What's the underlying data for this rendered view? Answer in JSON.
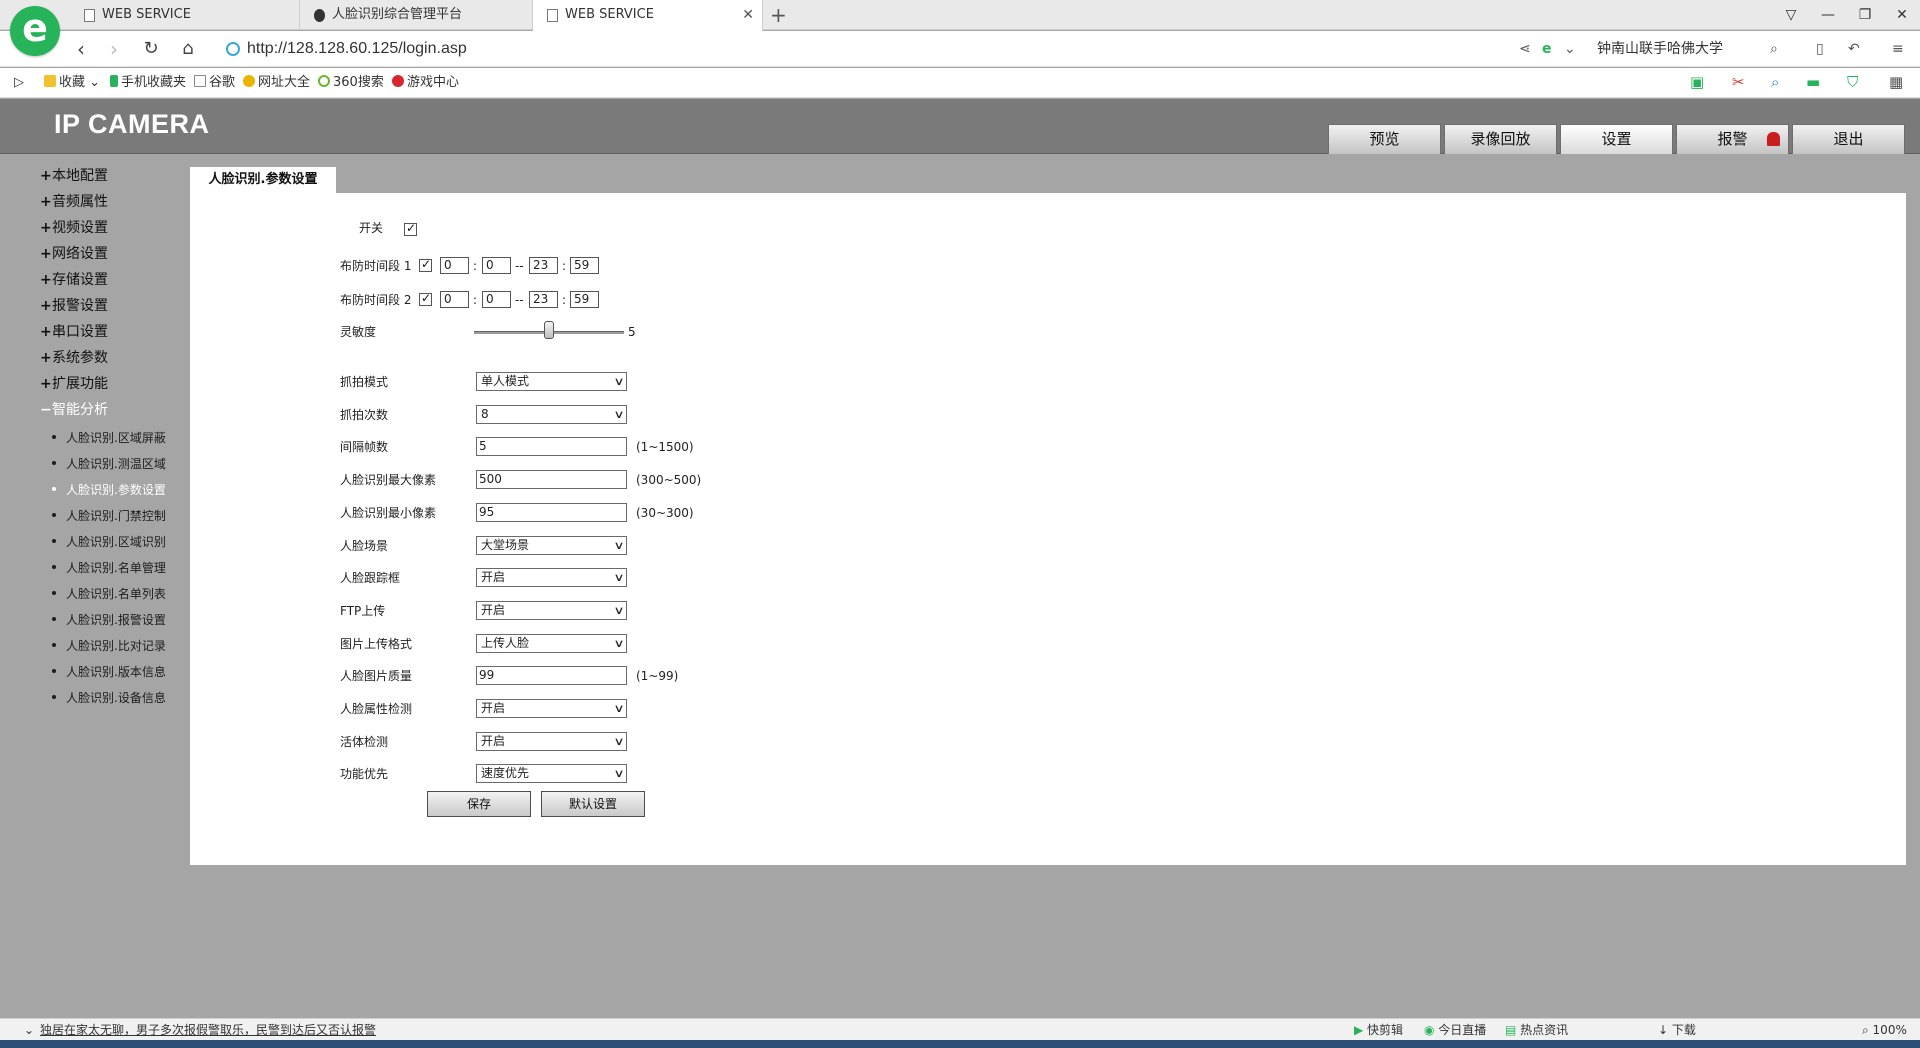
{
  "browser": {
    "tabs": [
      {
        "title": "WEB SERVICE"
      },
      {
        "title": "人脸识别综合管理平台"
      },
      {
        "title": "WEB SERVICE"
      }
    ],
    "address": "http://128.128.60.125/login.asp",
    "search_text": "钟南山联手哈佛大学",
    "bookmarks": [
      "收藏",
      "手机收藏夹",
      "谷歌",
      "网址大全",
      "360搜索",
      "游戏中心"
    ]
  },
  "app": {
    "brand": "IP CAMERA",
    "top_nav": [
      "预览",
      "录像回放",
      "设置",
      "报警",
      "退出"
    ],
    "sidebar_categories": [
      {
        "sign": "+",
        "label": "本地配置"
      },
      {
        "sign": "+",
        "label": "音频属性"
      },
      {
        "sign": "+",
        "label": "视频设置"
      },
      {
        "sign": "+",
        "label": "网络设置"
      },
      {
        "sign": "+",
        "label": "存储设置"
      },
      {
        "sign": "+",
        "label": "报警设置"
      },
      {
        "sign": "+",
        "label": "串口设置"
      },
      {
        "sign": "+",
        "label": "系统参数"
      },
      {
        "sign": "+",
        "label": "扩展功能"
      },
      {
        "sign": "−",
        "label": "智能分析"
      }
    ],
    "sidebar_sub": [
      "人脸识别.区域屏蔽",
      "人脸识别.测温区域",
      "人脸识别.参数设置",
      "人脸识别.门禁控制",
      "人脸识别.区域识别",
      "人脸识别.名单管理",
      "人脸识别.名单列表",
      "人脸识别.报警设置",
      "人脸识别.比对记录",
      "人脸识别.版本信息",
      "人脸识别.设备信息"
    ],
    "panel_title": "人脸识别.参数设置",
    "form": {
      "switch_label": "开关",
      "period1_label": "布防时间段 1",
      "period1": [
        "0",
        "0",
        "23",
        "59"
      ],
      "period2_label": "布防时间段 2",
      "period2": [
        "0",
        "0",
        "23",
        "59"
      ],
      "sensitivity_label": "灵敏度",
      "sensitivity_value": "5",
      "sensitivity_fraction": 0.5,
      "fields": [
        {
          "label": "抓拍模式",
          "type": "select",
          "value": "单人模式",
          "range": ""
        },
        {
          "label": "抓拍次数",
          "type": "select",
          "value": "8",
          "range": ""
        },
        {
          "label": "间隔帧数",
          "type": "input",
          "value": "5",
          "range": "(1~1500)"
        },
        {
          "label": "人脸识别最大像素",
          "type": "input",
          "value": "500",
          "range": "(300~500)"
        },
        {
          "label": "人脸识别最小像素",
          "type": "input",
          "value": "95",
          "range": "(30~300)"
        },
        {
          "label": "人脸场景",
          "type": "select",
          "value": "大堂场景",
          "range": ""
        },
        {
          "label": "人脸跟踪框",
          "type": "select",
          "value": "开启",
          "range": ""
        },
        {
          "label": "FTP上传",
          "type": "select",
          "value": "开启",
          "range": ""
        },
        {
          "label": "图片上传格式",
          "type": "select",
          "value": "上传人脸",
          "range": ""
        },
        {
          "label": "人脸图片质量",
          "type": "input",
          "value": "99",
          "range": "(1~99)"
        },
        {
          "label": "人脸属性检测",
          "type": "select",
          "value": "开启",
          "range": ""
        },
        {
          "label": "活体检测",
          "type": "select",
          "value": "开启",
          "range": ""
        },
        {
          "label": "功能优先",
          "type": "select",
          "value": "速度优先",
          "range": ""
        }
      ],
      "save_label": "保存",
      "default_label": "默认设置"
    }
  },
  "statusbar": {
    "news": "独居在家太无聊，男子多次报假警取乐，民警到达后又否认报警",
    "items": [
      "快剪辑",
      "今日直播",
      "热点资讯",
      "下载",
      "100%"
    ]
  }
}
